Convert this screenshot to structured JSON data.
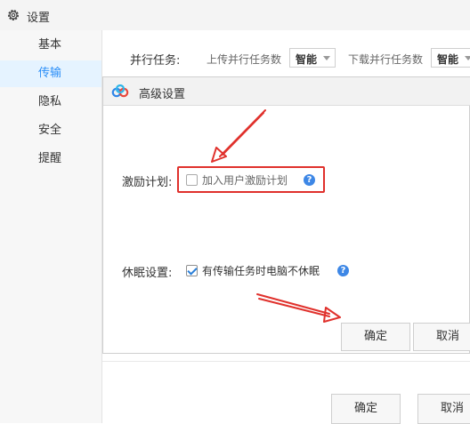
{
  "window": {
    "title": "设置",
    "icon": "gear-icon"
  },
  "sidebar": {
    "items": [
      {
        "label": "基本",
        "active": false
      },
      {
        "label": "传输",
        "active": true
      },
      {
        "label": "隐私",
        "active": false
      },
      {
        "label": "安全",
        "active": false
      },
      {
        "label": "提醒",
        "active": false
      }
    ]
  },
  "main": {
    "parallel": {
      "label": "并行任务:",
      "upload_label": "上传并行任务数",
      "upload_value": "智能",
      "download_label": "下载并行任务数",
      "download_value": "智能"
    },
    "buttons": {
      "ok": "确定",
      "cancel": "取消"
    }
  },
  "dialog": {
    "title": "高级设置",
    "logo": "baidu-netdisk-cloud-logo",
    "incentive": {
      "label": "激励计划:",
      "checkbox_label": "加入用户激励计划",
      "checked": false,
      "help_icon": "help-icon"
    },
    "sleep": {
      "label": "休眠设置:",
      "checkbox_label": "有传输任务时电脑不休眠",
      "checked": true,
      "help_icon": "help-icon"
    },
    "buttons": {
      "ok": "确定",
      "cancel": "取消"
    }
  },
  "annotation_colors": {
    "highlight": "#e0312c",
    "accent": "#2a8ef7"
  }
}
